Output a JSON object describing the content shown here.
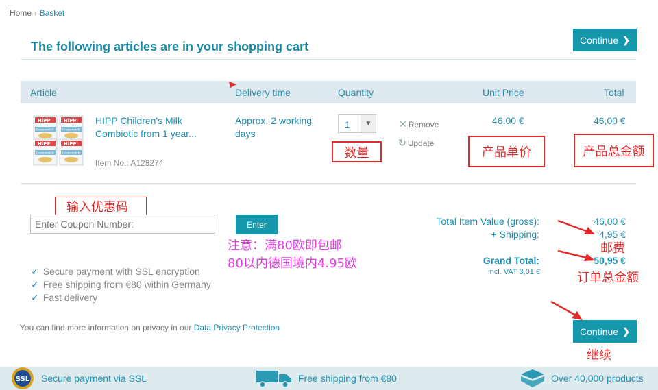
{
  "breadcrumb": {
    "home": "Home",
    "separator": "›",
    "current": "Basket"
  },
  "page_title": "The following articles are in your shopping cart",
  "buttons": {
    "continue": "Continue",
    "continue_chevron": "❯",
    "enter": "Enter"
  },
  "table": {
    "headers": {
      "article": "Article",
      "delivery": "Delivery time",
      "quantity": "Quantity",
      "unit_price": "Unit Price",
      "total": "Total"
    }
  },
  "product": {
    "image_icon": "hipp-product-image",
    "name": "HIPP Children's Milk Combiotic from 1 year...",
    "item_no": "Item No.: A128274",
    "delivery": "Approx. 2 working days",
    "quantity": "1",
    "remove_label": "Remove",
    "update_label": "Update",
    "unit_price": "46,00 €",
    "total": "46,00 €",
    "image_brand": "HiPP",
    "image_caption": "Kindermilch"
  },
  "coupon": {
    "placeholder": "Enter Coupon Number:"
  },
  "benefits": [
    "Secure payment with SSL encryption",
    "Free shipping from €80 within Germany",
    "Fast delivery"
  ],
  "benefit_tick": "✓",
  "summary": {
    "item_value_label": "Total Item Value (gross):",
    "item_value": "46,00 €",
    "shipping_label": "+ Shipping:",
    "shipping": "4,95 €",
    "grand_total_label": "Grand Total:",
    "grand_total": "50,95 €",
    "vat": "incl. VAT 3,01 €"
  },
  "privacy": {
    "text": "You can find more information on privacy in our ",
    "link": "Data Privacy Protection"
  },
  "footer": {
    "ssl": "Secure payment via SSL",
    "ssl_badge": "SSL",
    "shipping": "Free shipping from €80",
    "products": "Over 40,000 products"
  },
  "annotations": {
    "quantity": "数量",
    "unit_price": "产品单价",
    "total": "产品总金额",
    "coupon": "输入优惠码",
    "note_line1": "注意：满80欧即包邮",
    "note_line2": "80以内德国境内4.95欧",
    "shipping": "邮费",
    "grand_total": "订单总金额",
    "continue": "继续"
  },
  "colors": {
    "accent": "#1597ac",
    "link": "#1d8fb0",
    "annotation_red": "#e32a2a",
    "annotation_pink": "#e040e0"
  }
}
